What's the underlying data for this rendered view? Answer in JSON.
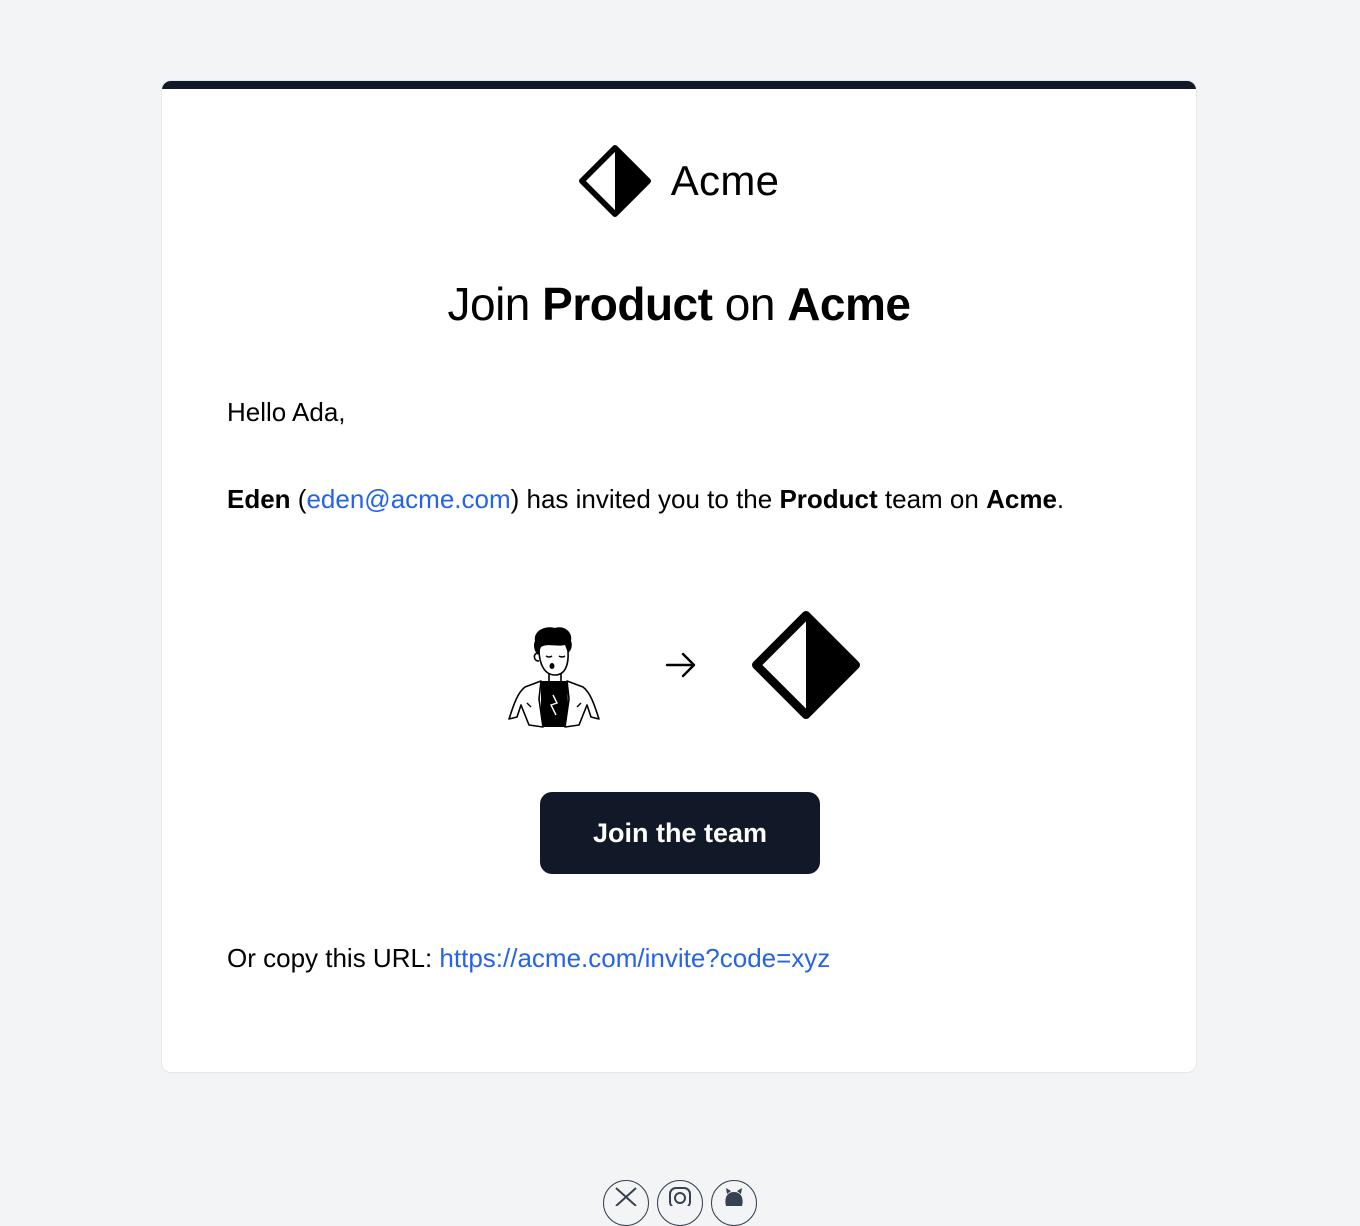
{
  "brand": {
    "name": "Acme",
    "logo_icon": "acme-diamond-logo"
  },
  "headline": {
    "prefix": "Join ",
    "team": "Product",
    "middle": " on ",
    "company": "Acme"
  },
  "greeting": "Hello Ada,",
  "invite": {
    "inviter_name": "Eden",
    "open_paren": " (",
    "inviter_email": "eden@acme.com",
    "text_1": ") has invited you to the ",
    "team": "Product",
    "text_2": " team on ",
    "company": "Acme",
    "text_3": "."
  },
  "illustration": {
    "avatar_icon": "user-avatar-illustration",
    "arrow_icon": "arrow-right-icon",
    "team_logo_icon": "acme-diamond-logo"
  },
  "cta": {
    "label": "Join the team"
  },
  "copy_url": {
    "prefix": "Or copy this URL: ",
    "url": "https://acme.com/invite?code=xyz"
  },
  "socials": [
    {
      "icon": "x-icon"
    },
    {
      "icon": "instagram-icon"
    },
    {
      "icon": "github-icon"
    }
  ],
  "colors": {
    "background": "#f3f4f6",
    "accent_dark": "#111827",
    "link": "#2563eb"
  }
}
